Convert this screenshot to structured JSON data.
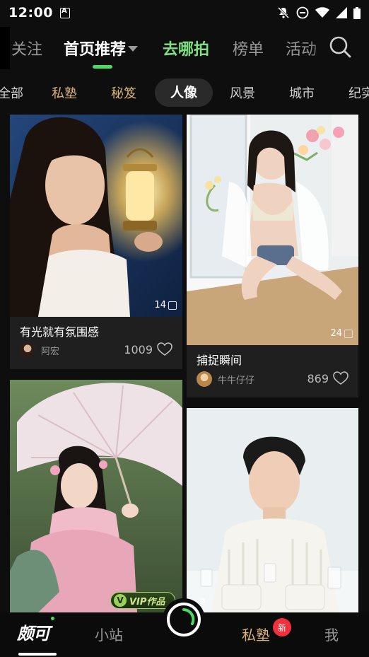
{
  "status_bar": {
    "time": "12:00"
  },
  "top_tabs": [
    {
      "label": "关注"
    },
    {
      "label": "首页推荐"
    },
    {
      "label": "去哪拍"
    },
    {
      "label": "榜单"
    },
    {
      "label": "活动"
    }
  ],
  "categories": [
    {
      "label": "全部"
    },
    {
      "label": "私塾"
    },
    {
      "label": "秘笈"
    },
    {
      "label": "人像"
    },
    {
      "label": "风景"
    },
    {
      "label": "城市"
    },
    {
      "label": "纪实"
    }
  ],
  "cards": [
    {
      "title": "有光就有氛围感",
      "author": "阿宏",
      "likes": "1009",
      "photo_count": "14"
    },
    {
      "title": "捕捉瞬间",
      "author": "牛牛仔仔",
      "likes": "869",
      "photo_count": "24"
    },
    {
      "vip_label": "VIP作品"
    },
    {}
  ],
  "bottom_nav": {
    "logo": "颇可",
    "items": [
      {
        "label": "小站"
      },
      {
        "label": "私塾"
      },
      {
        "label": "我"
      }
    ],
    "badge": "新"
  },
  "colors": {
    "accent_green": "#4cd964",
    "gold": "#d9b27a",
    "badge_red": "#f0303a"
  }
}
